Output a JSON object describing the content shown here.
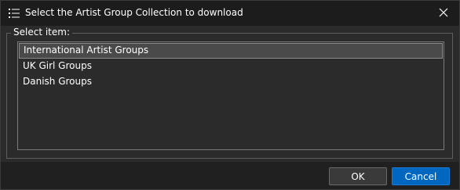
{
  "window": {
    "title": "Select the Artist Group Collection to download",
    "title_icon": "list-icon",
    "close_icon": "close-icon"
  },
  "group": {
    "label": "Select item:"
  },
  "list": {
    "items": [
      {
        "label": "International Artist Groups",
        "selected": true
      },
      {
        "label": "UK Girl Groups",
        "selected": false
      },
      {
        "label": "Danish Groups",
        "selected": false
      }
    ]
  },
  "buttons": {
    "ok_label": "OK",
    "cancel_label": "Cancel"
  },
  "colors": {
    "accent": "#0067c0",
    "background": "#2b2b2b",
    "titlebar": "#1c1c1c",
    "selection": "#4a4a4a"
  }
}
